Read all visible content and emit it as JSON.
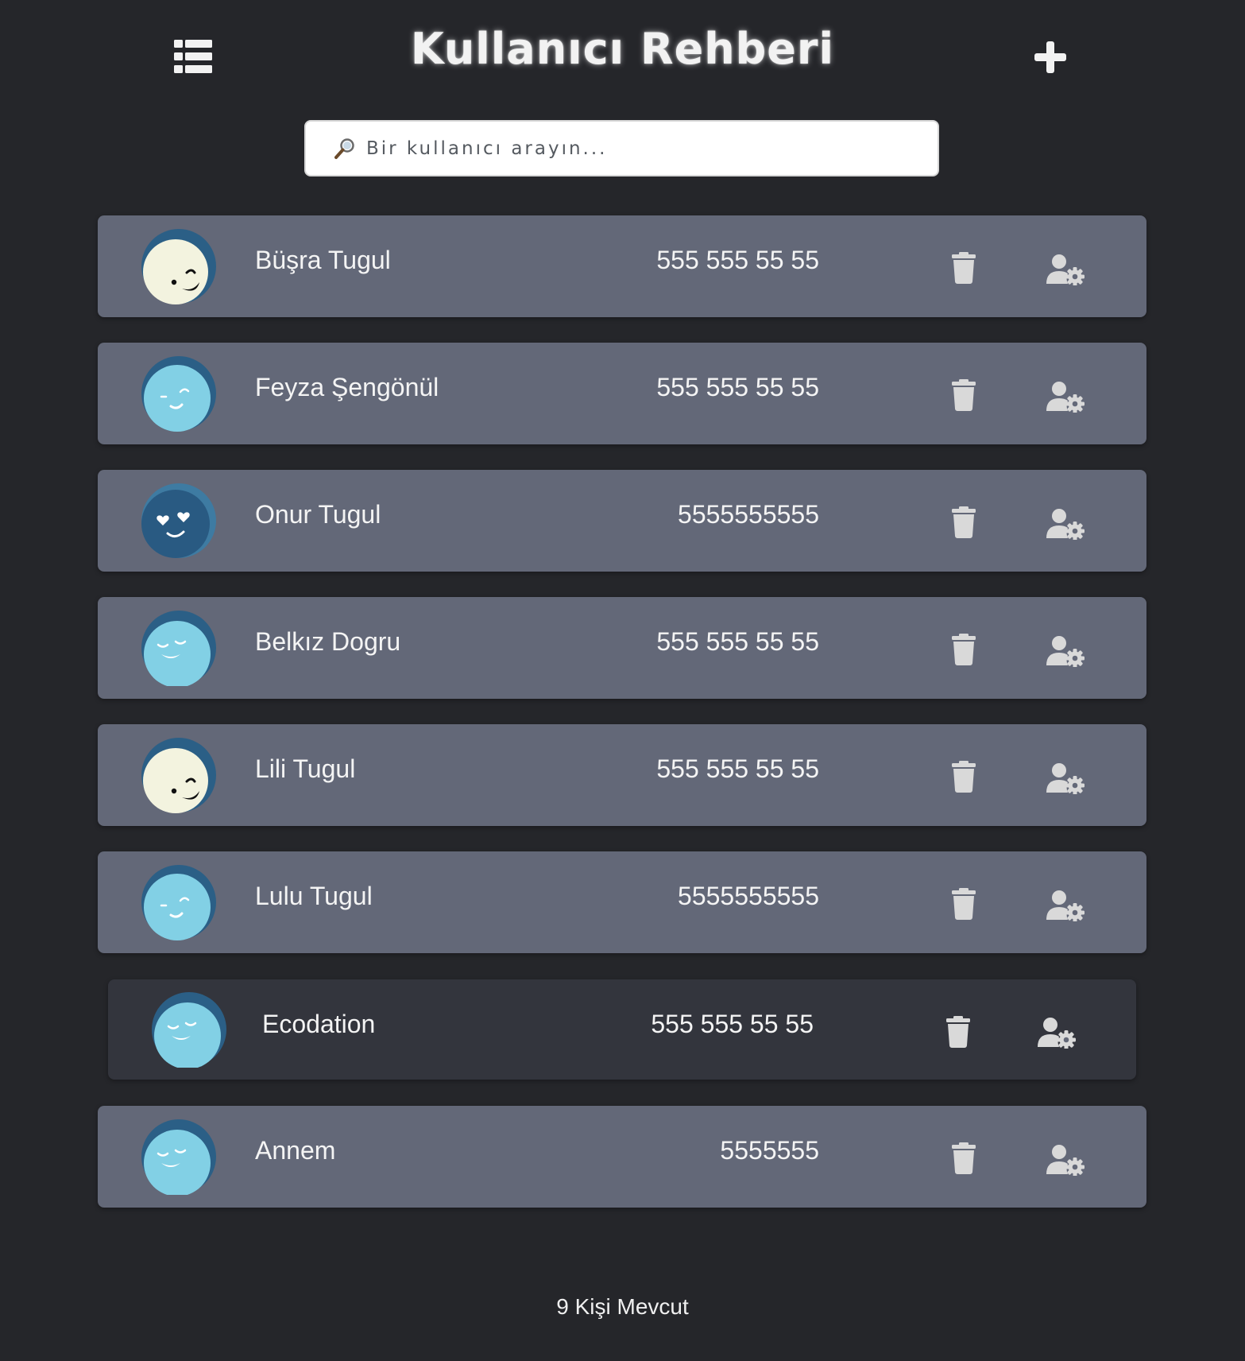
{
  "header": {
    "title": "Kullanıcı Rehberi",
    "menu_icon": "list-icon",
    "add_icon": "plus-icon"
  },
  "search": {
    "placeholder": "Bir kullanıcı arayın...",
    "value": "",
    "icon": "magnifier-icon"
  },
  "contacts": [
    {
      "name": "Büşra Tugul",
      "phone": "555 555 55 55",
      "avatar": "wink-cream",
      "selected": false
    },
    {
      "name": "Feyza Şengönül",
      "phone": "555 555 55 55",
      "avatar": "wink-light",
      "selected": false
    },
    {
      "name": "Onur Tugul",
      "phone": "5555555555",
      "avatar": "heart-eyes-dark",
      "selected": false
    },
    {
      "name": "Belkız Dogru",
      "phone": "555 555 55 55",
      "avatar": "content-light",
      "selected": false
    },
    {
      "name": "Lili Tugul",
      "phone": "555 555 55 55",
      "avatar": "wink-cream",
      "selected": false
    },
    {
      "name": "Lulu Tugul",
      "phone": "5555555555",
      "avatar": "wink-light",
      "selected": false
    },
    {
      "name": "Ecodation",
      "phone": "555 555 55 55",
      "avatar": "content-light",
      "selected": true
    },
    {
      "name": "Annem",
      "phone": "5555555",
      "avatar": "content-light",
      "selected": false
    }
  ],
  "row_icons": {
    "delete": "trash-icon",
    "edit": "user-cog-icon"
  },
  "footer": {
    "count_text": "9 Kişi Mevcut"
  },
  "colors": {
    "background": "#25262a",
    "card": "#636878",
    "card_selected": "#33353d",
    "avatar_blue": "#2b5f86",
    "avatar_light": "#82d0e5",
    "avatar_cream": "#f3f3df",
    "icon_grey": "#d9d9d9"
  }
}
